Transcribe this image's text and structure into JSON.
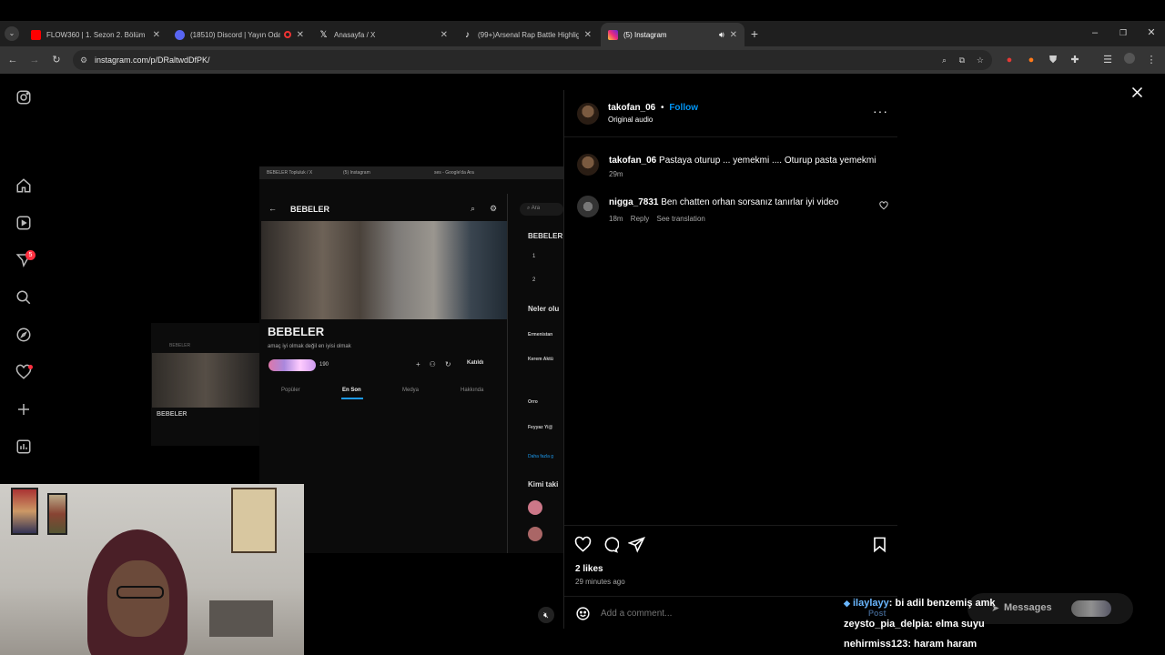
{
  "browser": {
    "tabs": [
      {
        "title": "FLOW360 | 1. Sezon 2. Bölüm -",
        "favicon_color": "#ff0000",
        "active": false
      },
      {
        "title": "(18510) Discord | Yayın Oda",
        "favicon_color": "#5865f2",
        "active": false
      },
      {
        "title": "Anasayfa / X",
        "favicon_color": "#ffffff",
        "active": false
      },
      {
        "title": "(99+)Arsenal Rap Battle Highlig",
        "favicon_color": "#25f4ee",
        "active": false
      },
      {
        "title": "(5) Instagram",
        "favicon_color": "#e1306c",
        "active": true
      }
    ],
    "url": "instagram.com/p/DRaltwdDfPK/"
  },
  "sidebar": {
    "notification_count": "5",
    "icons": [
      "instagram-icon",
      "home-icon",
      "reels-icon",
      "messages-icon",
      "search-icon",
      "explore-icon",
      "notifications-icon",
      "create-icon",
      "dashboard-icon"
    ]
  },
  "post": {
    "author": "takofan_06",
    "follow_label": "Follow",
    "separator": "•",
    "audio": "Original audio",
    "comments": [
      {
        "user": "takofan_06",
        "text": "Pastaya oturup ... yemekmi .... Oturup pasta yemekmi",
        "time": "29m"
      },
      {
        "user": "nigga_7831",
        "text": "Ben chatten orhan sorsanız tanırlar iyi video",
        "time": "18m",
        "reply": "Reply",
        "translate": "See translation"
      }
    ],
    "likes": "2 likes",
    "posted": "29 minutes ago",
    "comment_placeholder": "Add a comment...",
    "post_label": "Post"
  },
  "embedded": {
    "title": "BEBELER",
    "subtitle": "amaç iyi olmak değil en iyisi olmak",
    "member_count": "190",
    "join_label": "Katıldı",
    "tabs": [
      "Popüler",
      "En Son",
      "Medya",
      "Hakkında"
    ],
    "search_placeholder": "Ara",
    "right_title": "BEBELER",
    "ranks": [
      "1",
      "2"
    ],
    "neler_title": "Neler olu",
    "kimi_title": "Kimi taki",
    "trend_items": [
      "Ermenistan",
      "Kerem Aktü",
      "Orro",
      "Feyyaz Yi@"
    ],
    "show_more": "Daha fazla g",
    "browser_tabs": [
      "BEBELER Topluluk / X",
      "(5) Instagram",
      "ses - Google'da Ara"
    ],
    "mini_title": "BEBELER"
  },
  "chat": [
    {
      "user": "ilaylayy",
      "message": ": bi adil benzemiş amk",
      "color": "#6ab7ff"
    },
    {
      "user": "zeysto_pia_delpia",
      "message": ": elma suyu",
      "color": "#ffffff"
    },
    {
      "user": "nehirmiss123",
      "message": ": haram haram",
      "color": "#ffffff"
    }
  ],
  "messages_widget": {
    "label": "Messages"
  }
}
